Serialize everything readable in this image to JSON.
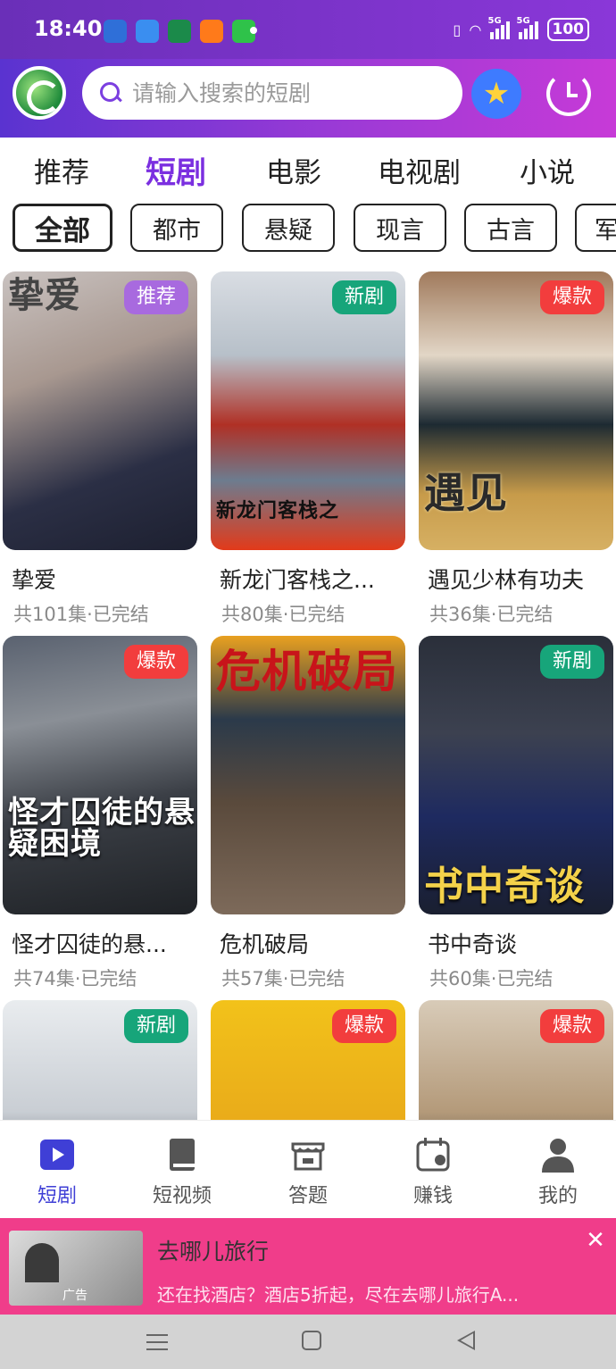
{
  "status_bar": {
    "time": "18:40",
    "network_1": "5G",
    "network_2": "5G",
    "battery": "100"
  },
  "search": {
    "placeholder": "请输入搜索的短剧"
  },
  "category_tabs": [
    {
      "label": "推荐",
      "active": false
    },
    {
      "label": "短剧",
      "active": true
    },
    {
      "label": "电影",
      "active": false
    },
    {
      "label": "电视剧",
      "active": false
    },
    {
      "label": "小说",
      "active": false
    }
  ],
  "filter_chips": [
    {
      "label": "全部",
      "active": true
    },
    {
      "label": "都市",
      "active": false
    },
    {
      "label": "悬疑",
      "active": false
    },
    {
      "label": "现言",
      "active": false
    },
    {
      "label": "古言",
      "active": false
    },
    {
      "label": "军",
      "active": false
    }
  ],
  "dramas": [
    {
      "title": "挚爱",
      "meta": "共101集·已完结",
      "badge": "推荐",
      "badge_type": "rec",
      "poster_text": "挚爱"
    },
    {
      "title": "新龙门客栈之...",
      "meta": "共80集·已完结",
      "badge": "新剧",
      "badge_type": "new",
      "poster_text": "新龙门客栈之"
    },
    {
      "title": "遇见少林有功夫",
      "meta": "共36集·已完结",
      "badge": "爆款",
      "badge_type": "hot",
      "poster_text": "遇见"
    },
    {
      "title": "怪才囚徒的悬...",
      "meta": "共74集·已完结",
      "badge": "爆款",
      "badge_type": "hot",
      "poster_text": "怪才囚徒的悬疑困境"
    },
    {
      "title": "危机破局",
      "meta": "共57集·已完结",
      "badge": "",
      "badge_type": "",
      "poster_text": "危机破局"
    },
    {
      "title": "书中奇谈",
      "meta": "共60集·已完结",
      "badge": "新剧",
      "badge_type": "new",
      "poster_text": "书中奇谈"
    },
    {
      "title": "",
      "meta": "",
      "badge": "新剧",
      "badge_type": "new",
      "poster_text": ""
    },
    {
      "title": "",
      "meta": "",
      "badge": "爆款",
      "badge_type": "hot",
      "poster_text": ""
    },
    {
      "title": "",
      "meta": "",
      "badge": "爆款",
      "badge_type": "hot",
      "poster_text": ""
    }
  ],
  "bottom_nav": [
    {
      "label": "短剧",
      "icon": "play-icon",
      "active": true
    },
    {
      "label": "短视频",
      "icon": "book-icon",
      "active": false
    },
    {
      "label": "答题",
      "icon": "shop-icon",
      "active": false
    },
    {
      "label": "赚钱",
      "icon": "calendar-icon",
      "active": false
    },
    {
      "label": "我的",
      "icon": "user-icon",
      "active": false
    }
  ],
  "ad": {
    "title": "去哪儿旅行",
    "description": "还在找酒店？酒店5折起，尽在去哪儿旅行A...",
    "label": "广告",
    "close": "✕"
  },
  "colors": {
    "brand": "#7b2fe0",
    "badge_rec": "#a86adf",
    "badge_new": "#17a57a",
    "badge_hot": "#f23d3d",
    "ad_bg": "#f03d8a"
  }
}
